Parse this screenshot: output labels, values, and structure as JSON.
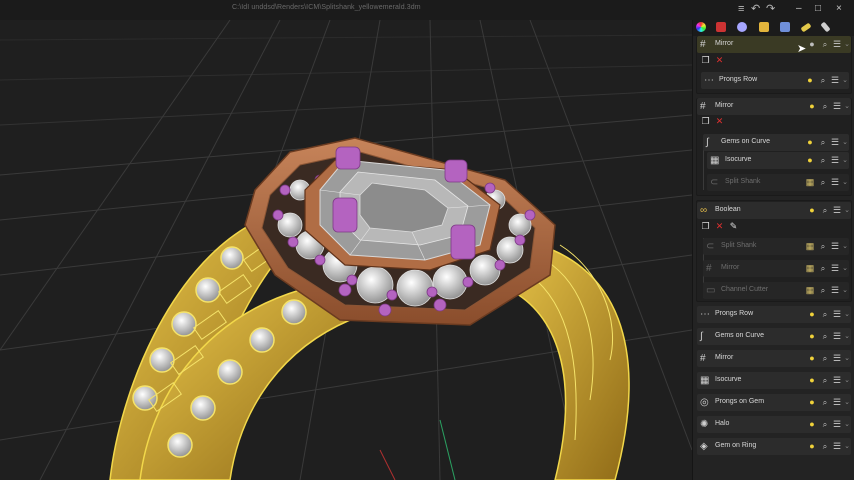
{
  "window": {
    "title": "C:\\IdI unddsd\\Renders\\ICM\\Splitshank_yellowemerald.3dm",
    "undo_icon": "undo-icon",
    "redo_icon": "redo-icon",
    "minimize": "–",
    "maximize": "□",
    "close": "×"
  },
  "panel": {
    "toolbar_icons": [
      "color-wheel-icon",
      "material-icon",
      "layers-icon",
      "folder-icon",
      "image-icon",
      "pencil-icon",
      "wrench-icon"
    ],
    "items": [
      {
        "label": "Mirror",
        "icon": "grid-icon",
        "state": "active"
      },
      {
        "label": "Prongs Row",
        "icon": "prongs-row-icon",
        "state": "normal"
      },
      {
        "label": "Mirror",
        "icon": "grid-icon",
        "state": "normal"
      },
      {
        "label": "Gems on Curve",
        "icon": "curve-icon",
        "state": "normal"
      },
      {
        "label": "Isocurve",
        "icon": "isocurve-icon",
        "state": "normal"
      },
      {
        "label": "Split Shank",
        "icon": "split-shank-icon",
        "state": "dim"
      },
      {
        "label": "Boolean",
        "icon": "boolean-icon",
        "state": "normal"
      },
      {
        "label": "Split Shank",
        "icon": "split-shank-icon",
        "state": "dim"
      },
      {
        "label": "Mirror",
        "icon": "grid-icon",
        "state": "dim"
      },
      {
        "label": "Channel Cutter",
        "icon": "channel-cutter-icon",
        "state": "dim"
      },
      {
        "label": "Prongs Row",
        "icon": "prongs-row-icon",
        "state": "normal"
      },
      {
        "label": "Gems on Curve",
        "icon": "curve-icon",
        "state": "normal"
      },
      {
        "label": "Mirror",
        "icon": "grid-icon",
        "state": "normal"
      },
      {
        "label": "Isocurve",
        "icon": "isocurve-icon",
        "state": "normal"
      },
      {
        "label": "Prongs on Gem",
        "icon": "prongs-gem-icon",
        "state": "normal"
      },
      {
        "label": "Halo",
        "icon": "halo-icon",
        "state": "normal"
      },
      {
        "label": "Gem on Ring",
        "icon": "gem-ring-icon",
        "state": "normal"
      }
    ]
  },
  "colors": {
    "gold": "#d7b23a",
    "gold_wire": "#f2d84a",
    "bezel": "#b46e44",
    "prong": "#b463c0",
    "gem": "#9a9a9a",
    "grid": "#3c3c3c"
  }
}
